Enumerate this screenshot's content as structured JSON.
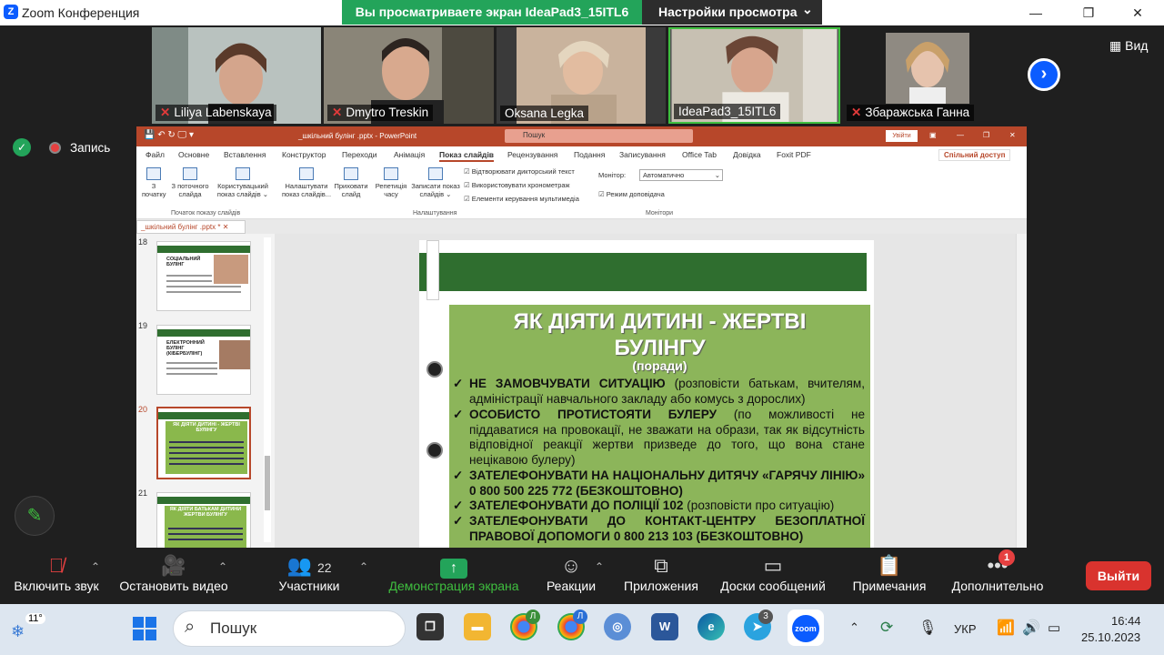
{
  "window": {
    "title": "Zoom Конференция",
    "minimize": "—",
    "maximize": "❐",
    "close": "✕"
  },
  "share_banner": {
    "text": "Вы просматриваете экран IdeaPad3_15ITL6",
    "view_settings": "Настройки просмотра",
    "caret": "⌄"
  },
  "participants": [
    {
      "name": "Liliya Labenskaya",
      "muted": true
    },
    {
      "name": "Dmytro Treskin",
      "muted": true
    },
    {
      "name": "Oksana Legka",
      "muted": false
    },
    {
      "name": "IdeaPad3_15ITL6",
      "muted": false
    },
    {
      "name": "Збаражська Ганна",
      "muted": true
    }
  ],
  "view_button": "Вид",
  "recording": {
    "label": "Запись"
  },
  "powerpoint": {
    "doc_title": "_шкільний булінг .pptx - PowerPoint",
    "search": "Пошук",
    "login": "Увійти",
    "menu": [
      "Файл",
      "Основне",
      "Вставлення",
      "Конструктор",
      "Переходи",
      "Анімація",
      "Показ слайдів",
      "Рецензування",
      "Подання",
      "Записування",
      "Office Tab",
      "Довідка",
      "Foxit PDF"
    ],
    "active_menu": "Показ слайдів",
    "share_access": "Спільний доступ",
    "ribbon": {
      "from_start": "З\nпочатку",
      "from_current": "З поточного\nслайда",
      "custom_show": "Користувацький\nпоказ слайдів ⌄",
      "setup": "Налаштувати\nпоказ слайдів...",
      "hide": "Приховати\nслайд",
      "rehearse": "Репетиція\nчасу",
      "record": "Записати показ\nслайдів ⌄",
      "chk_narration": "Відтворювати дикторський текст",
      "chk_timings": "Використовувати хронометраж",
      "chk_media": "Елементи керування мультимедіа",
      "monitor_label": "Монітор:",
      "monitor_value": "Автоматично",
      "presenter_view": "Режим доповідача",
      "group_start": "Початок показу слайдів",
      "group_setup": "Налаштування",
      "group_monitors": "Монітори"
    },
    "tab_name": "_шкільний булінг .pptx *",
    "thumbs": [
      {
        "num": "18",
        "title": "СОЦІАЛЬНИЙ БУЛІНГ"
      },
      {
        "num": "19",
        "title": "ЕЛЕКТРОННИЙ БУЛІНГ (КІБЕРБУЛІНГ)"
      },
      {
        "num": "20",
        "title": "ЯК ДІЯТИ ДИТИНІ - ЖЕРТВІ БУЛІНГУ"
      },
      {
        "num": "21",
        "title": "ЯК ДІЯТИ БАТЬКАМ ДИТИНИ ЖЕРТВИ БУЛІНГУ"
      }
    ],
    "slide": {
      "title": "ЯК ДІЯТИ ДИТИНІ - ЖЕРТВІ БУЛІНГУ",
      "subtitle": "(поради)",
      "tips": [
        {
          "bold": "НЕ ЗАМОВЧУВАТИ СИТУАЦІЮ",
          "rest": " (розповісти батькам, вчителям, адміністрації навчального закладу або комусь з дорослих)"
        },
        {
          "bold": "ОСОБИСТО ПРОТИСТОЯТИ БУЛЕРУ",
          "rest": " (по можливості не піддаватися на провокації, не зважати на образи, так як відсутність відповідної  реакції жертви призведе до того, що вона стане нецікавою булеру)"
        },
        {
          "bold": "ЗАТЕЛЕФОНУВАТИ НА НАЦІОНАЛЬНУ ДИТЯЧУ «ГАРЯЧУ ЛІНІЮ» 0 800 500 225 772 (БЕЗКОШТОВНО)",
          "rest": ""
        },
        {
          "bold": "ЗАТЕЛЕФОНУВАТИ ДО ПОЛІЦІЇ 102",
          "rest": " (розповісти про ситуацію)"
        },
        {
          "bold": "ЗАТЕЛЕФОНУВАТИ ДО КОНТАКТ-ЦЕНТРУ БЕЗОПЛАТНОЇ ПРАВОВОЇ ДОПОМОГИ 0 800 213 103 (БЕЗКОШТОВНО)",
          "rest": ""
        }
      ]
    }
  },
  "toolbar": {
    "mute": "Включить звук",
    "video": "Остановить видео",
    "participants": "Участники",
    "participants_count": "22",
    "share": "Демонстрация экрана",
    "reactions": "Реакции",
    "apps": "Приложения",
    "whiteboards": "Доски сообщений",
    "notes": "Примечания",
    "more": "Дополнительно",
    "more_badge": "1",
    "leave": "Выйти"
  },
  "taskbar": {
    "weather": "11°",
    "search": "Пошук",
    "chrome_badge": "Л",
    "telegram_badge": "3",
    "lang": "УКР",
    "time": "16:44",
    "date": "25.10.2023"
  },
  "colors": {
    "zoom_blue": "#0b5cff",
    "share_green": "#23a45a",
    "ppt_red": "#b7472a",
    "slide_green": "#8cb55a",
    "leave_red": "#d9332e"
  }
}
